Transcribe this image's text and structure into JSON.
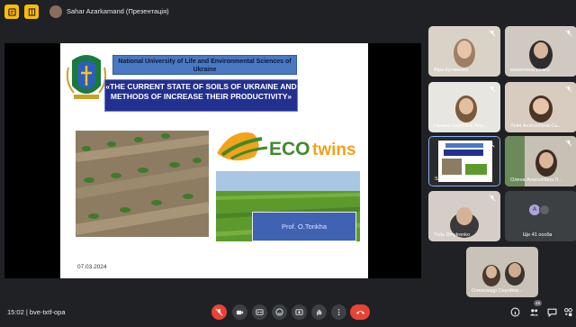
{
  "topbar": {
    "presenter_label": "Sahar Azarkamand (Презентація)"
  },
  "slide": {
    "university": "National University of Life and Environmental Sciences of Ukraine",
    "title": "«THE CURRENT STATE OF SOILS OF UKRAINE AND METHODS OF INCREASE THEIR PRODUCTIVITY»",
    "eco_logo_text": "ECOtwins",
    "author": "Prof. O.Tonkha",
    "date": "07.03.2024"
  },
  "participants": [
    {
      "name": "Віра Кутовенко"
    },
    {
      "name": "валентина рожко"
    },
    {
      "name": "Галина Сергіївна Анд..."
    },
    {
      "name": "Лілія Анатоліївна Са..."
    },
    {
      "name": "Sahar Azarkamand"
    },
    {
      "name": "Олена Анатоліївна Л..."
    },
    {
      "name": "Yulia Dmytrenko"
    },
    {
      "name": "Ще 41 особа",
      "avatar_letter": "A"
    },
    {
      "name": "Олександр Сергійов..."
    }
  ],
  "bottombar": {
    "time_code": "15:02  |  bve-txtf-opa",
    "participants_badge": "49"
  },
  "colors": {
    "background": "#202124",
    "tile": "#3c4043",
    "hangup": "#ea4335",
    "uni_box": "#4a79c3",
    "title_box": "#22318f"
  }
}
